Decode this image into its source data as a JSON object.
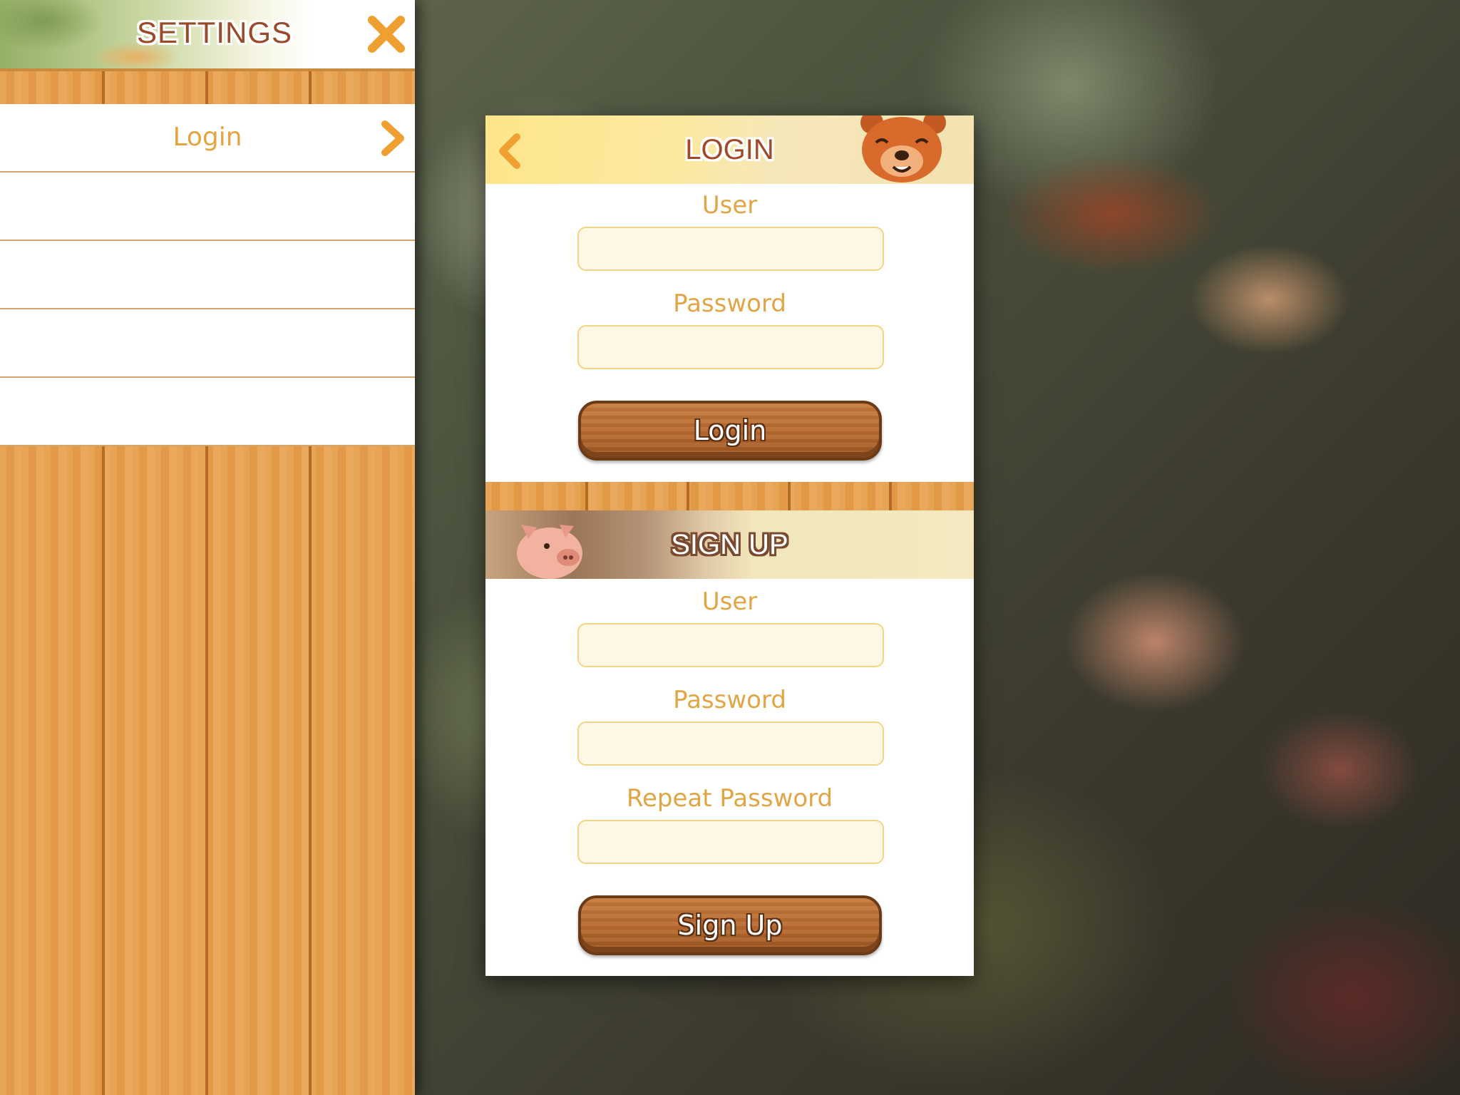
{
  "settings": {
    "title": "SETTINGS",
    "menu": [
      {
        "label": "Login",
        "has_arrow": true
      },
      {
        "label": ""
      },
      {
        "label": ""
      },
      {
        "label": ""
      },
      {
        "label": ""
      }
    ]
  },
  "login": {
    "title": "LOGIN",
    "user_label": "User",
    "user_value": "",
    "password_label": "Password",
    "password_value": "",
    "button_label": "Login"
  },
  "signup": {
    "title": "SIGN UP",
    "user_label": "User",
    "user_value": "",
    "password_label": "Password",
    "password_value": "",
    "repeat_label": "Repeat Password",
    "repeat_value": "",
    "button_label": "Sign Up"
  },
  "colors": {
    "accent": "#e2a545",
    "title_brown": "#a14a2a",
    "wood": "#e6a150",
    "button_wood": "#b86a2e"
  },
  "icons": {
    "close": "close-icon",
    "menu_arrow": "chevron-right-icon",
    "back": "back-icon",
    "bear": "bear-icon",
    "pig": "pig-icon"
  }
}
